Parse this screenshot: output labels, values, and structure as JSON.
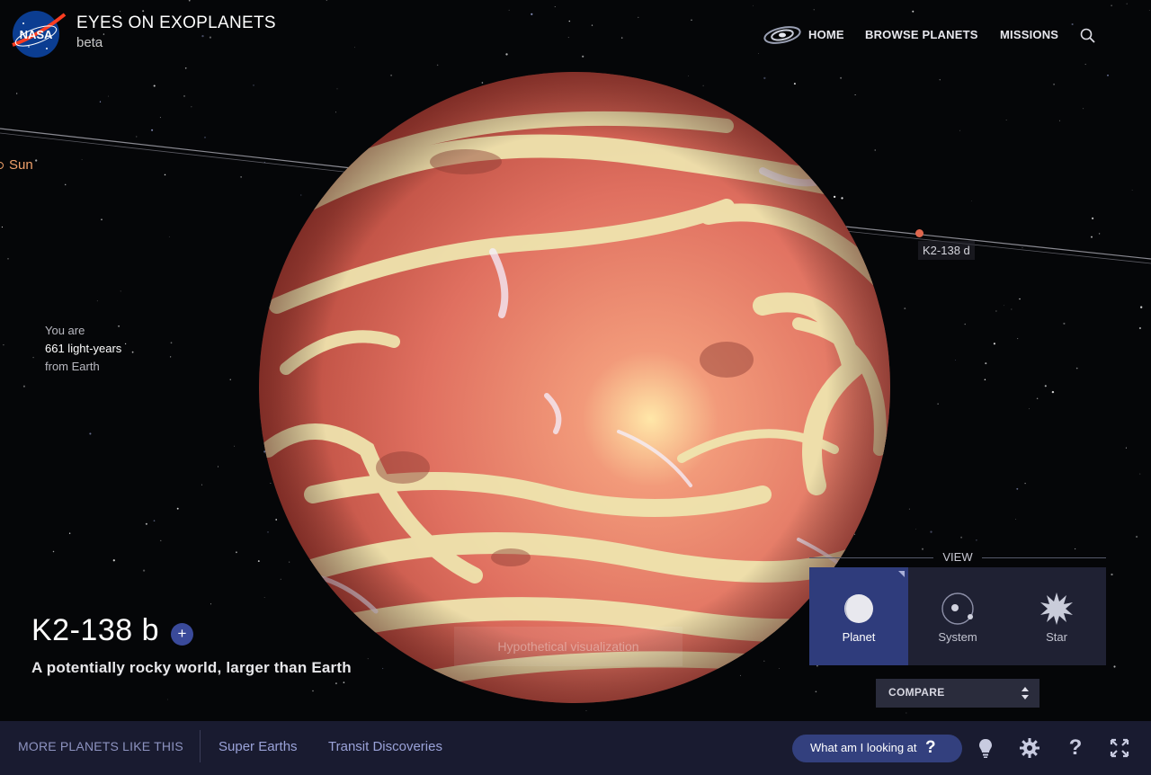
{
  "header": {
    "logo_text": "NASA",
    "title": "EYES ON EXOPLANETS",
    "subtitle": "beta",
    "nav": [
      {
        "label": "HOME",
        "icon": "galaxy-icon"
      },
      {
        "label": "BROWSE PLANETS"
      },
      {
        "label": "MISSIONS"
      }
    ],
    "search_icon": "search-icon"
  },
  "scene": {
    "sun_label": "Sun",
    "neighbor_label": "K2-138 d",
    "distance": {
      "line1": "You are",
      "value": "661 light-years",
      "line3": "from Earth"
    },
    "watermark": "Hypothetical visualization",
    "colors": {
      "planet_base": "#e0735e",
      "clouds": "#efe7b0",
      "background": "#050608"
    }
  },
  "planet": {
    "name": "K2-138 b",
    "add_label": "+",
    "tagline": "A potentially rocky world, larger than Earth"
  },
  "view": {
    "title": "VIEW",
    "options": [
      {
        "label": "Planet",
        "icon": "planet-icon",
        "active": true
      },
      {
        "label": "System",
        "icon": "system-icon",
        "active": false
      },
      {
        "label": "Star",
        "icon": "star-icon",
        "active": false
      }
    ],
    "compare_label": "COMPARE"
  },
  "bottom_bar": {
    "more_label": "MORE PLANETS LIKE THIS",
    "links": [
      "Super Earths",
      "Transit Discoveries"
    ],
    "help_button": {
      "label": "What am I looking at",
      "symbol": "?"
    },
    "icons": [
      "lightbulb-icon",
      "gear-icon",
      "help-icon",
      "fullscreen-icon"
    ],
    "help_symbol": "?"
  },
  "accent_colors": {
    "active": "#2f3c7c",
    "bar": "#191b30",
    "link": "#9aa2d8"
  }
}
